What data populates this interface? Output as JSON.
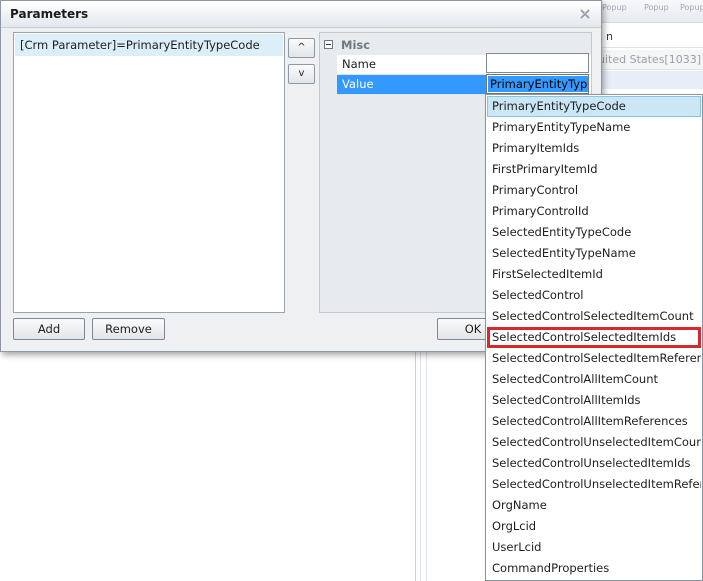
{
  "background": {
    "popup_labels": [
      "Popup",
      "Popup",
      "Popup"
    ],
    "header_right": "n",
    "locale": "uited States[1033]"
  },
  "dialog": {
    "title": "Parameters",
    "close_icon": "close-icon",
    "parameters": [
      "[Crm Parameter]=PrimaryEntityTypeCode"
    ],
    "move_up_label": "^",
    "move_down_label": "v",
    "add_label": "Add",
    "remove_label": "Remove",
    "ok_label": "OK"
  },
  "property_grid": {
    "category": "Misc",
    "properties": [
      {
        "name": "Name",
        "value": ""
      },
      {
        "name": "Value",
        "value": "PrimaryEntityTypeCode"
      }
    ]
  },
  "dropdown": {
    "selected": "PrimaryEntityTypeCode",
    "highlighted": "SelectedControlSelectedItemIds",
    "options": [
      "PrimaryEntityTypeCode",
      "PrimaryEntityTypeName",
      "PrimaryItemIds",
      "FirstPrimaryItemId",
      "PrimaryControl",
      "PrimaryControlId",
      "SelectedEntityTypeCode",
      "SelectedEntityTypeName",
      "FirstSelectedItemId",
      "SelectedControl",
      "SelectedControlSelectedItemCount",
      "SelectedControlSelectedItemIds",
      "SelectedControlSelectedItemReferences",
      "SelectedControlAllItemCount",
      "SelectedControlAllItemIds",
      "SelectedControlAllItemReferences",
      "SelectedControlUnselectedItemCount",
      "SelectedControlUnselectedItemIds",
      "SelectedControlUnselectedItemReferences",
      "OrgName",
      "OrgLcid",
      "UserLcid",
      "CommandProperties"
    ]
  },
  "colors": {
    "selection_blue": "#3399ff",
    "list_selected": "#cbe6f5",
    "highlight_red": "#d9272e"
  }
}
